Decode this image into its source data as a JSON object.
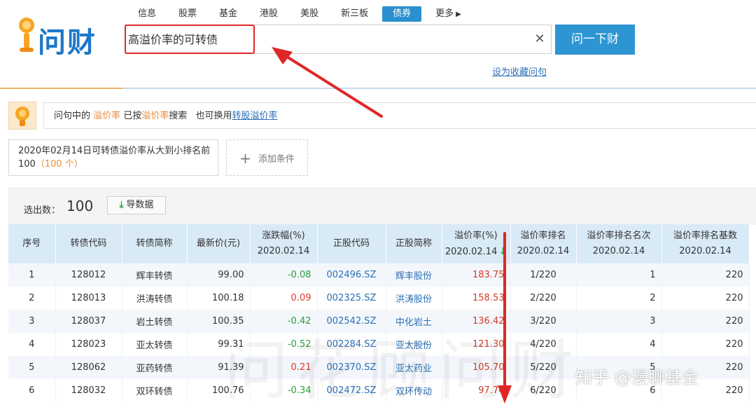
{
  "logo": {
    "text": "问财"
  },
  "nav": {
    "items": [
      {
        "label": "信息"
      },
      {
        "label": "股票"
      },
      {
        "label": "基金"
      },
      {
        "label": "港股"
      },
      {
        "label": "美股"
      },
      {
        "label": "新三板"
      },
      {
        "label": "债券",
        "active": true
      },
      {
        "label": "更多"
      }
    ]
  },
  "search": {
    "value": "高溢价率的可转债",
    "button_label": "问一下财",
    "clear_icon": "close-icon"
  },
  "favorite_link": "设为收藏问句",
  "notice": {
    "p1": "问句中的",
    "term1": "溢价率",
    "p2": "已按",
    "term2": "溢价率",
    "p3": "搜索",
    "p4": "也可换用",
    "alt_link": "转股溢价率"
  },
  "condition": {
    "text": "2020年02月14日可转债溢价率从大到小排名前100",
    "count": "（100 个）",
    "add_label": "添加条件"
  },
  "results": {
    "label": "选出数：",
    "count": "100",
    "export_label": "导数据"
  },
  "table": {
    "headers": [
      {
        "l1": "序号",
        "l2": ""
      },
      {
        "l1": "转债代码",
        "l2": ""
      },
      {
        "l1": "转债简称",
        "l2": ""
      },
      {
        "l1": "最新价(元)",
        "l2": ""
      },
      {
        "l1": "涨跌幅(%)",
        "l2": "2020.02.14"
      },
      {
        "l1": "正股代码",
        "l2": ""
      },
      {
        "l1": "正股简称",
        "l2": ""
      },
      {
        "l1": "溢价率(%)",
        "l2": "2020.02.14"
      },
      {
        "l1": "溢价率排名",
        "l2": "2020.02.14"
      },
      {
        "l1": "溢价率排名名次",
        "l2": "2020.02.14"
      },
      {
        "l1": "溢价率排名基数",
        "l2": "2020.02.14"
      }
    ],
    "rows": [
      {
        "idx": "1",
        "code": "128012",
        "name": "辉丰转债",
        "price": "99.00",
        "chg": "-0.08",
        "stock_code": "002496.SZ",
        "stock_name": "辉丰股份",
        "premium": "183.75",
        "rank": "1/220",
        "rank_no": "1",
        "rank_base": "220"
      },
      {
        "idx": "2",
        "code": "128013",
        "name": "洪涛转债",
        "price": "100.18",
        "chg": "0.09",
        "stock_code": "002325.SZ",
        "stock_name": "洪涛股份",
        "premium": "158.53",
        "rank": "2/220",
        "rank_no": "2",
        "rank_base": "220"
      },
      {
        "idx": "3",
        "code": "128037",
        "name": "岩土转债",
        "price": "100.35",
        "chg": "-0.42",
        "stock_code": "002542.SZ",
        "stock_name": "中化岩土",
        "premium": "136.42",
        "rank": "3/220",
        "rank_no": "3",
        "rank_base": "220"
      },
      {
        "idx": "4",
        "code": "128023",
        "name": "亚太转债",
        "price": "99.31",
        "chg": "-0.52",
        "stock_code": "002284.SZ",
        "stock_name": "亚太股份",
        "premium": "121.30",
        "rank": "4/220",
        "rank_no": "4",
        "rank_base": "220"
      },
      {
        "idx": "5",
        "code": "128062",
        "name": "亚药转债",
        "price": "91.39",
        "chg": "0.21",
        "stock_code": "002370.SZ",
        "stock_name": "亚太药业",
        "premium": "105.70",
        "rank": "5/220",
        "rank_no": "5",
        "rank_base": "220"
      },
      {
        "idx": "6",
        "code": "128032",
        "name": "双环转债",
        "price": "100.76",
        "chg": "-0.34",
        "stock_code": "002472.SZ",
        "stock_name": "双环传动",
        "premium": "97.74",
        "rank": "6/220",
        "rank_no": "6",
        "rank_base": "220"
      }
    ]
  },
  "watermark": "问花顾问财",
  "overlay_credit": "知乎 @漫聊基金",
  "colors": {
    "accent": "#2e95d3",
    "annotation_red": "#e02727",
    "highlight_orange": "#ea8a37",
    "up_red": "#e0362f",
    "down_green": "#2a9b3e"
  }
}
